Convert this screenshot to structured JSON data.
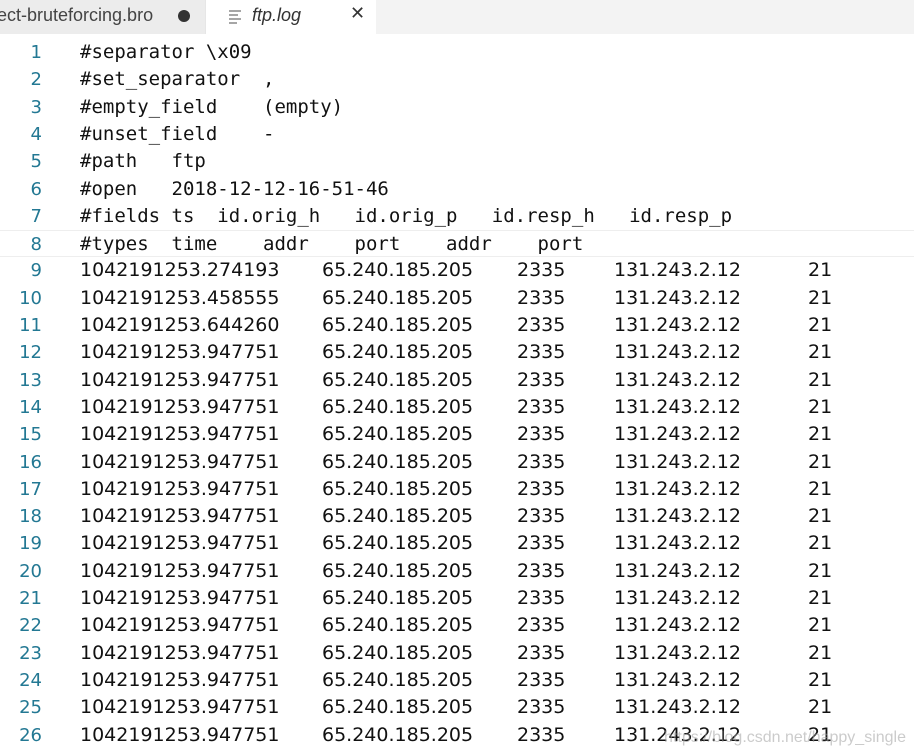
{
  "tabs": [
    {
      "label": "tect-bruteforcing.bro",
      "state": "modified",
      "icon": "dot-icon"
    },
    {
      "label": "ftp.log",
      "state": "active",
      "icon": "file-icon",
      "close": "✕"
    }
  ],
  "header_lines": [
    {
      "number": "1",
      "text": "#separator \\x09"
    },
    {
      "number": "2",
      "text": "#set_separator  ,"
    },
    {
      "number": "3",
      "text": "#empty_field    (empty)"
    },
    {
      "number": "4",
      "text": "#unset_field    -"
    },
    {
      "number": "5",
      "text": "#path   ftp"
    },
    {
      "number": "6",
      "text": "#open   2018-12-12-16-51-46"
    },
    {
      "number": "7",
      "text": "#fields ts  id.orig_h   id.orig_p   id.resp_h   id.resp_p"
    },
    {
      "number": "8",
      "text": "#types  time    addr    port    addr    port"
    }
  ],
  "data_rows": [
    {
      "number": "9",
      "ts": "1042191253.274193",
      "orig_h": "65.240.185.205",
      "orig_p": "2335",
      "resp_h": "131.243.2.12",
      "resp_p": "21"
    },
    {
      "number": "10",
      "ts": "1042191253.458555",
      "orig_h": "65.240.185.205",
      "orig_p": "2335",
      "resp_h": "131.243.2.12",
      "resp_p": "21"
    },
    {
      "number": "11",
      "ts": "1042191253.644260",
      "orig_h": "65.240.185.205",
      "orig_p": "2335",
      "resp_h": "131.243.2.12",
      "resp_p": "21"
    },
    {
      "number": "12",
      "ts": "1042191253.947751",
      "orig_h": "65.240.185.205",
      "orig_p": "2335",
      "resp_h": "131.243.2.12",
      "resp_p": "21"
    },
    {
      "number": "13",
      "ts": "1042191253.947751",
      "orig_h": "65.240.185.205",
      "orig_p": "2335",
      "resp_h": "131.243.2.12",
      "resp_p": "21"
    },
    {
      "number": "14",
      "ts": "1042191253.947751",
      "orig_h": "65.240.185.205",
      "orig_p": "2335",
      "resp_h": "131.243.2.12",
      "resp_p": "21"
    },
    {
      "number": "15",
      "ts": "1042191253.947751",
      "orig_h": "65.240.185.205",
      "orig_p": "2335",
      "resp_h": "131.243.2.12",
      "resp_p": "21"
    },
    {
      "number": "16",
      "ts": "1042191253.947751",
      "orig_h": "65.240.185.205",
      "orig_p": "2335",
      "resp_h": "131.243.2.12",
      "resp_p": "21"
    },
    {
      "number": "17",
      "ts": "1042191253.947751",
      "orig_h": "65.240.185.205",
      "orig_p": "2335",
      "resp_h": "131.243.2.12",
      "resp_p": "21"
    },
    {
      "number": "18",
      "ts": "1042191253.947751",
      "orig_h": "65.240.185.205",
      "orig_p": "2335",
      "resp_h": "131.243.2.12",
      "resp_p": "21"
    },
    {
      "number": "19",
      "ts": "1042191253.947751",
      "orig_h": "65.240.185.205",
      "orig_p": "2335",
      "resp_h": "131.243.2.12",
      "resp_p": "21"
    },
    {
      "number": "20",
      "ts": "1042191253.947751",
      "orig_h": "65.240.185.205",
      "orig_p": "2335",
      "resp_h": "131.243.2.12",
      "resp_p": "21"
    },
    {
      "number": "21",
      "ts": "1042191253.947751",
      "orig_h": "65.240.185.205",
      "orig_p": "2335",
      "resp_h": "131.243.2.12",
      "resp_p": "21"
    },
    {
      "number": "22",
      "ts": "1042191253.947751",
      "orig_h": "65.240.185.205",
      "orig_p": "2335",
      "resp_h": "131.243.2.12",
      "resp_p": "21"
    },
    {
      "number": "23",
      "ts": "1042191253.947751",
      "orig_h": "65.240.185.205",
      "orig_p": "2335",
      "resp_h": "131.243.2.12",
      "resp_p": "21"
    },
    {
      "number": "24",
      "ts": "1042191253.947751",
      "orig_h": "65.240.185.205",
      "orig_p": "2335",
      "resp_h": "131.243.2.12",
      "resp_p": "21"
    },
    {
      "number": "25",
      "ts": "1042191253.947751",
      "orig_h": "65.240.185.205",
      "orig_p": "2335",
      "resp_h": "131.243.2.12",
      "resp_p": "21"
    },
    {
      "number": "26",
      "ts": "1042191253.947751",
      "orig_h": "65.240.185.205",
      "orig_p": "2335",
      "resp_h": "131.243.2.12",
      "resp_p": "21"
    }
  ],
  "watermark": "https://blog.csdn.net/happy_single",
  "colors": {
    "line_number": "#237893",
    "text": "#111111",
    "tabbar": "#f3f3f3"
  }
}
